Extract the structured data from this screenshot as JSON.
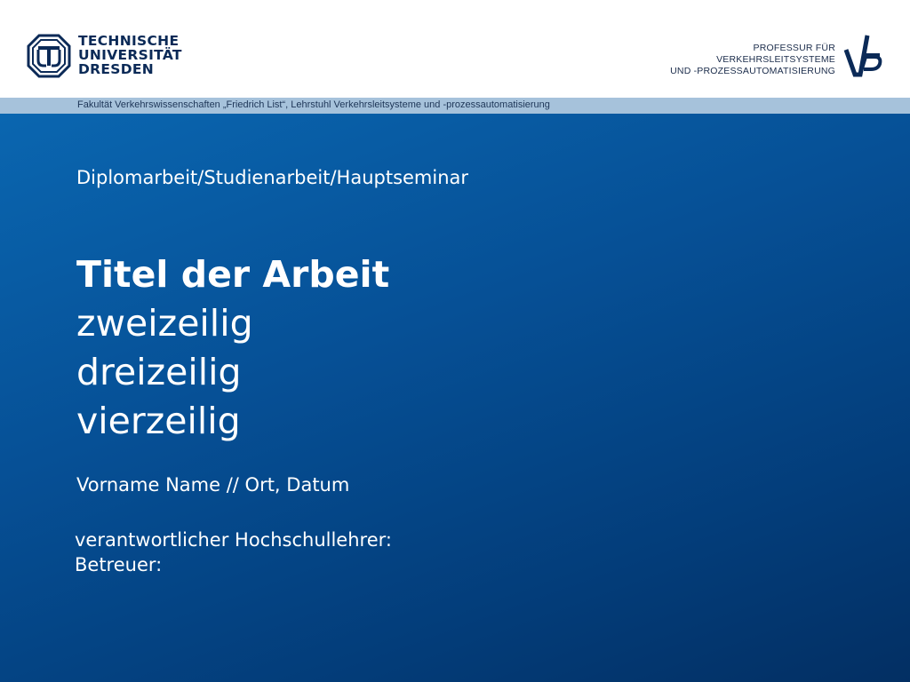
{
  "header": {
    "university_lines": [
      "TECHNISCHE",
      "UNIVERSITÄT",
      "DRESDEN"
    ],
    "chair_lines": [
      "PROFESSUR FÜR",
      "VERKEHRSLEITSYSTEME",
      "UND -PROZESSAUTOMATISIERUNG"
    ],
    "tud_logo_icon": "tu-dresden-logo-icon",
    "vlp_logo_icon": "vlp-logo-icon",
    "brand_color": "#0b2a57"
  },
  "faculty_bar": {
    "text": "Fakultät Verkehrswissenschaften „Friedrich List“, Lehrstuhl Verkehrsleitsysteme und -prozessautomatisierung",
    "color": "#a6c2db"
  },
  "slide": {
    "subtitle": "Diplomarbeit/Studienarbeit/Hauptseminar",
    "title": "Titel der Arbeit",
    "title_lines": [
      "zweizeilig",
      "dreizeilig",
      "vierzeilig"
    ],
    "author": "Vorname Name // Ort, Datum",
    "supervisor": "verantwortlicher Hochschullehrer:",
    "advisor": "Betreuer:",
    "background_color": "#065096"
  }
}
